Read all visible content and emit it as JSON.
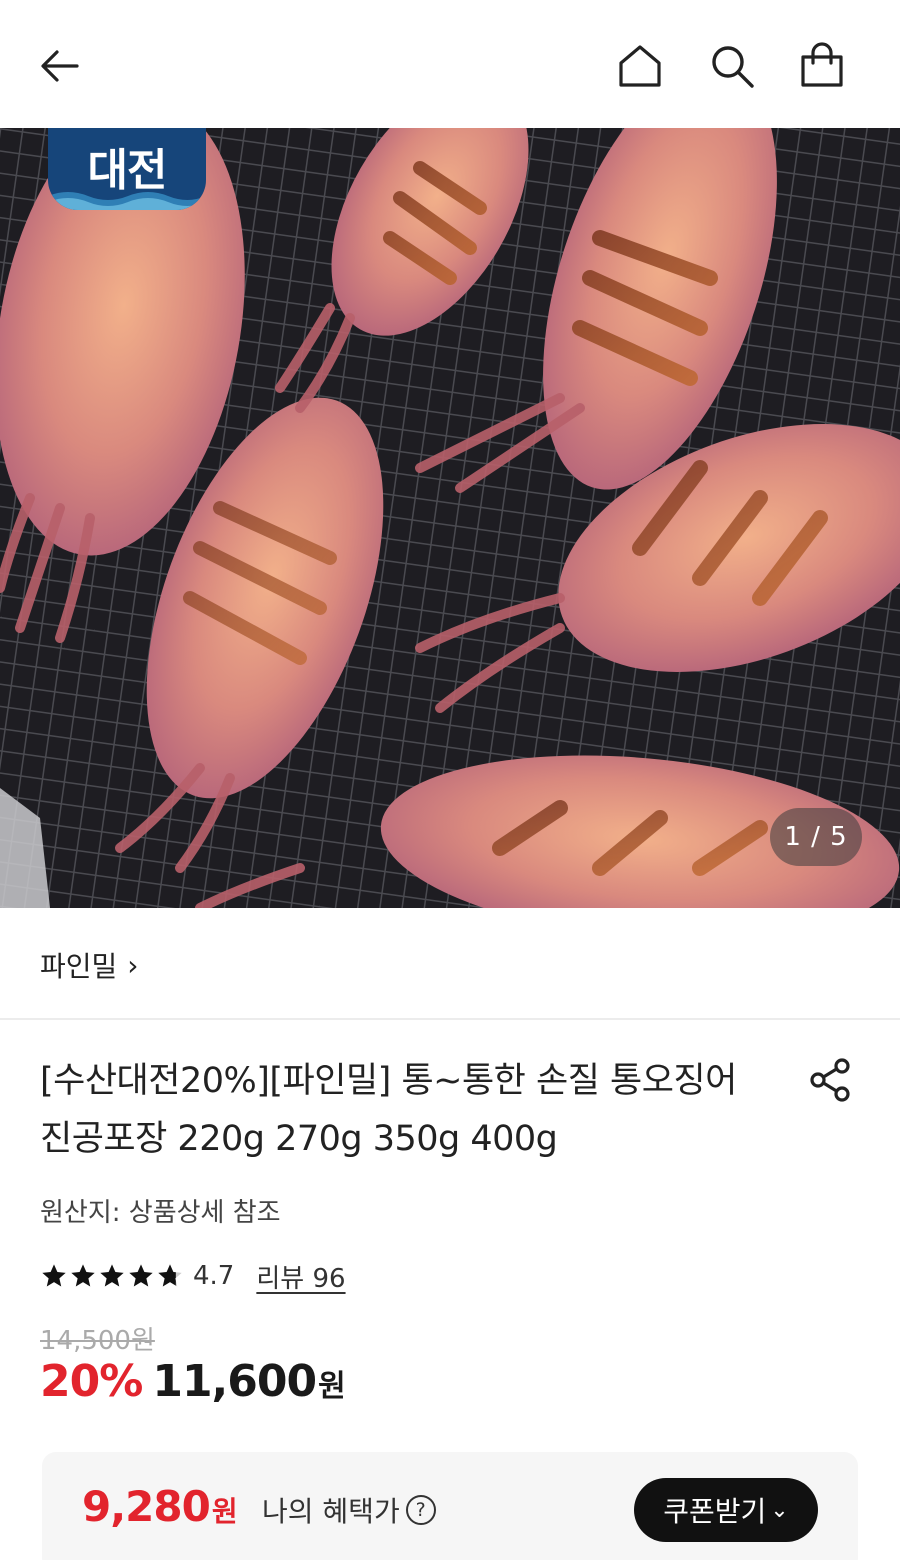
{
  "header": {
    "back_icon": "arrow-left-icon",
    "home_icon": "home-icon",
    "search_icon": "search-icon",
    "bag_icon": "shopping-bag-icon"
  },
  "hero": {
    "badge_text": "대전",
    "counter": "1 / 5",
    "image_subject": "grilled squid on grill rack"
  },
  "seller": {
    "name": "파인밀",
    "chevron": "›"
  },
  "product": {
    "title": "[수산대전20%][파인밀] 통~통한 손질 통오징어 진공포장 220g 270g 350g 400g",
    "origin": "원산지: 상품상세 참조",
    "rating": "4.7",
    "rating_stars": 4.7,
    "review_link": "리뷰 96",
    "original_price": "14,500원",
    "discount": "20%",
    "price": "11,600",
    "price_unit": "원"
  },
  "benefit": {
    "price": "9,280",
    "price_unit": "원",
    "label": "나의 혜택가",
    "help": "?",
    "coupon_button": "쿠폰받기",
    "coupon_chevron": "⌄"
  },
  "colors": {
    "accent_red": "#e2242d",
    "badge_blue": "#16457a",
    "dark_button": "#111111"
  }
}
